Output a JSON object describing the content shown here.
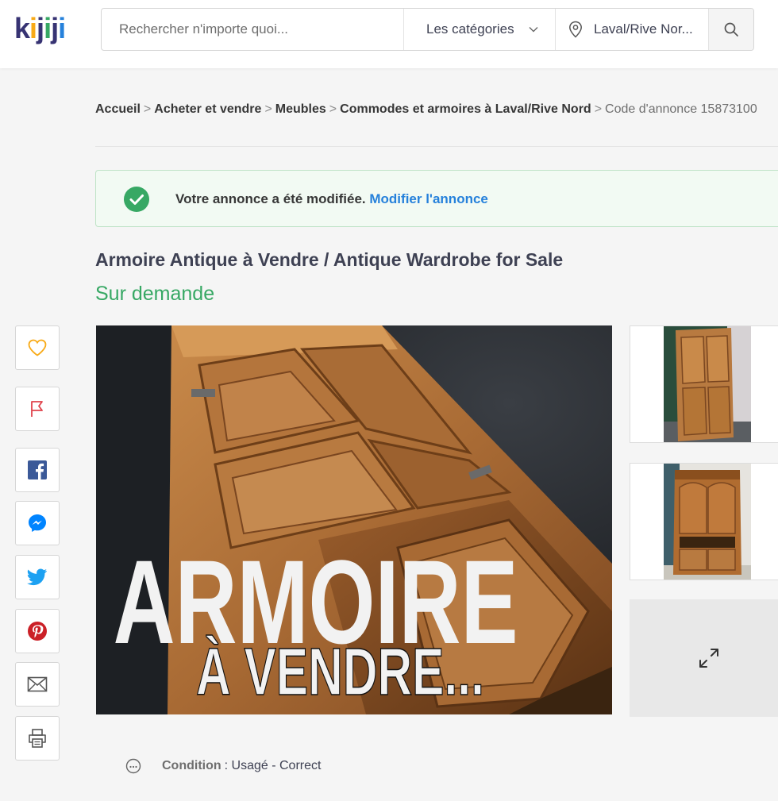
{
  "header": {
    "logo_letters": [
      "k",
      "i",
      "j",
      "i",
      "j",
      "i"
    ],
    "logo_colors": [
      "#373373",
      "#f8aa17",
      "#373373",
      "#37a864",
      "#373373",
      "#2681db"
    ],
    "search_placeholder": "Rechercher n'importe quoi...",
    "category_label": "Les catégories",
    "location_label": "Laval/Rive Nor..."
  },
  "breadcrumb": {
    "items": [
      "Accueil",
      "Acheter et vendre",
      "Meubles",
      "Commodes et armoires à Laval/Rive Nord"
    ],
    "current": "Code d'annonce 15873100",
    "separator": ">"
  },
  "alert": {
    "message": "Votre annonce a été modifiée.",
    "link": "Modifier l'annonce"
  },
  "listing": {
    "title": "Armoire Antique à Vendre / Antique Wardrobe for Sale",
    "price": "Sur demande",
    "image_text_line1": "ARMOIRE",
    "image_text_line2": "À VENDRE...",
    "condition_label": "Condition",
    "condition_value": "Usagé - Correct"
  },
  "side_actions": [
    "heart-icon",
    "flag-icon",
    "facebook-icon",
    "messenger-icon",
    "twitter-icon",
    "pinterest-icon",
    "email-icon",
    "print-icon"
  ],
  "colors": {
    "brand_dark": "#373373",
    "green": "#37a864",
    "blue": "#2681db",
    "facebook": "#3b5998",
    "messenger": "#0084ff",
    "twitter": "#1da1f2",
    "pinterest": "#cb2027",
    "heart": "#f8aa17",
    "flag": "#e0434c"
  }
}
